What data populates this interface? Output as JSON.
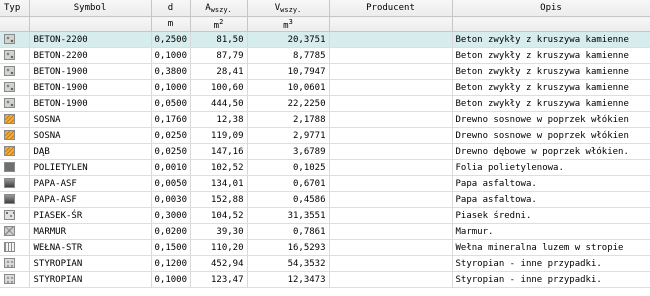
{
  "header": {
    "typ": "Typ",
    "symbol": "Symbol",
    "d": "d",
    "a_main": "A",
    "a_sub": "wszy.",
    "v_main": "V",
    "v_sub": "wszy.",
    "producent": "Producent",
    "opis": "Opis"
  },
  "units": {
    "d": "m",
    "a": "m",
    "a_exp": "2",
    "v": "m",
    "v_exp": "3"
  },
  "rows": [
    {
      "pattern": "concrete-swatch-icon",
      "symbol": "BETON-2200",
      "d": "0,2500",
      "a": "81,50",
      "v": "20,3751",
      "producent": "",
      "opis": "Beton zwykły z kruszywa kamienne",
      "selected": true
    },
    {
      "pattern": "concrete-swatch-icon",
      "symbol": "BETON-2200",
      "d": "0,1000",
      "a": "87,79",
      "v": "8,7785",
      "producent": "",
      "opis": "Beton zwykły z kruszywa kamienne"
    },
    {
      "pattern": "concrete-swatch-icon",
      "symbol": "BETON-1900",
      "d": "0,3800",
      "a": "28,41",
      "v": "10,7947",
      "producent": "",
      "opis": "Beton zwykły z kruszywa kamienne"
    },
    {
      "pattern": "concrete-swatch-icon",
      "symbol": "BETON-1900",
      "d": "0,1000",
      "a": "100,60",
      "v": "10,0601",
      "producent": "",
      "opis": "Beton zwykły z kruszywa kamienne"
    },
    {
      "pattern": "concrete-swatch-icon",
      "symbol": "BETON-1900",
      "d": "0,0500",
      "a": "444,50",
      "v": "22,2250",
      "producent": "",
      "opis": "Beton zwykły z kruszywa kamienne"
    },
    {
      "pattern": "wood-swatch-icon",
      "symbol": "SOSNA",
      "d": "0,1760",
      "a": "12,38",
      "v": "2,1788",
      "producent": "",
      "opis": "Drewno sosnowe w poprzek włókien"
    },
    {
      "pattern": "wood-swatch-icon",
      "symbol": "SOSNA",
      "d": "0,0250",
      "a": "119,09",
      "v": "2,9771",
      "producent": "",
      "opis": "Drewno sosnowe w poprzek włókien"
    },
    {
      "pattern": "wood-swatch-icon",
      "symbol": "DĄB",
      "d": "0,0250",
      "a": "147,16",
      "v": "3,6789",
      "producent": "",
      "opis": "Drewno dębowe w poprzek włókien."
    },
    {
      "pattern": "foil-swatch-icon",
      "symbol": "POLIETYLEN",
      "d": "0,0010",
      "a": "102,52",
      "v": "0,1025",
      "producent": "",
      "opis": "Folia polietylenowa."
    },
    {
      "pattern": "tar-paper-swatch-icon",
      "symbol": "PAPA-ASF",
      "d": "0,0050",
      "a": "134,01",
      "v": "0,6701",
      "producent": "",
      "opis": "Papa asfaltowa."
    },
    {
      "pattern": "tar-paper-swatch-icon",
      "symbol": "PAPA-ASF",
      "d": "0,0030",
      "a": "152,88",
      "v": "0,4586",
      "producent": "",
      "opis": "Papa asfaltowa."
    },
    {
      "pattern": "sand-swatch-icon",
      "symbol": "PIASEK-ŚR",
      "d": "0,3000",
      "a": "104,52",
      "v": "31,3551",
      "producent": "",
      "opis": "Piasek średni."
    },
    {
      "pattern": "marble-swatch-icon",
      "symbol": "MARMUR",
      "d": "0,0200",
      "a": "39,30",
      "v": "0,7861",
      "producent": "",
      "opis": "Marmur."
    },
    {
      "pattern": "wool-swatch-icon",
      "symbol": "WEŁNA-STR",
      "d": "0,1500",
      "a": "110,20",
      "v": "16,5293",
      "producent": "",
      "opis": "Wełna mineralna luzem w stropie"
    },
    {
      "pattern": "styrofoam-swatch-icon",
      "symbol": "STYROPIAN",
      "d": "0,1200",
      "a": "452,94",
      "v": "54,3532",
      "producent": "",
      "opis": "Styropian - inne przypadki."
    },
    {
      "pattern": "styrofoam-swatch-icon",
      "symbol": "STYROPIAN",
      "d": "0,1000",
      "a": "123,47",
      "v": "12,3473",
      "producent": "",
      "opis": "Styropian - inne przypadki."
    }
  ],
  "colors": {
    "selected_row": "#d7ecec",
    "header_bg": "#ececec",
    "grid_line": "#d9d9d9"
  }
}
